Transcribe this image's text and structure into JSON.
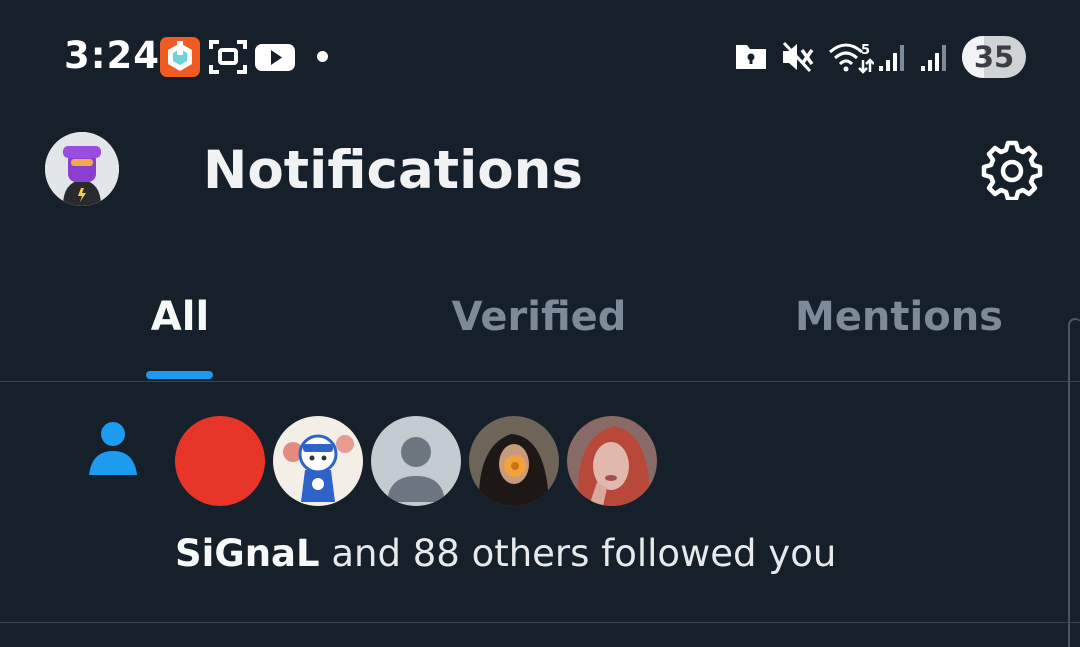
{
  "status_bar": {
    "time": "3:24",
    "battery_level": "35",
    "battery_fraction": 0.35,
    "app_icons": [
      "hotspot-app-icon",
      "screen-capture-icon",
      "youtube-icon"
    ],
    "system_icons": [
      "folder-lock-icon",
      "vibrate-mute-icon",
      "wifi-icon",
      "cell-signal-icon",
      "cell-signal-icon"
    ],
    "wifi_badge": "5"
  },
  "header": {
    "title": "Notifications",
    "settings_icon": "gear-icon"
  },
  "tabs": [
    {
      "label": "All",
      "active": true
    },
    {
      "label": "Verified",
      "active": false
    },
    {
      "label": "Mentions",
      "active": false
    }
  ],
  "notification": {
    "icon": "person-icon",
    "avatars": [
      "red-circle-avatar",
      "cartoon-avatar",
      "default-avatar",
      "photo-avatar",
      "photo-avatar"
    ],
    "name": "SiGnaL",
    "text": " and 88 others followed you"
  },
  "colors": {
    "background": "#15202b",
    "accent": "#1d9bf0",
    "muted_text": "#7d8b98"
  }
}
